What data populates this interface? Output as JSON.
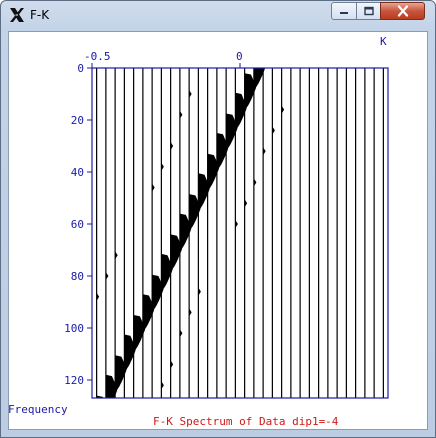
{
  "window": {
    "title": "F-K",
    "minimize_icon": "minimize-icon",
    "maximize_icon": "maximize-icon",
    "close_icon": "close-icon",
    "app_icon": "x11-icon"
  },
  "plot": {
    "k_label": "K",
    "frequency_label": "Frequency",
    "caption": "F-K Spectrum of Data dip1=-4",
    "x_ticks": [
      "-0.5",
      "0"
    ],
    "y_ticks": [
      "0",
      "20",
      "40",
      "60",
      "80",
      "100",
      "120"
    ],
    "axis_color": "#1a1aa6",
    "caption_color": "#d01818"
  },
  "chart_data": {
    "type": "wiggle",
    "title": "F-K Spectrum of Data dip1=-4",
    "xlabel": "K",
    "ylabel": "Frequency",
    "xlim": [
      -0.5,
      0.5
    ],
    "ylim": [
      0,
      128
    ],
    "y_axis_inverted": true,
    "x_tick_labels": [
      "-0.5",
      "0"
    ],
    "y_tick_labels": [
      "0",
      "20",
      "40",
      "60",
      "80",
      "100",
      "120"
    ],
    "trace_count": 32,
    "energy_band": [
      {
        "frequency": 0,
        "k": 0.03
      },
      {
        "frequency": 124,
        "k": -0.47
      }
    ]
  }
}
